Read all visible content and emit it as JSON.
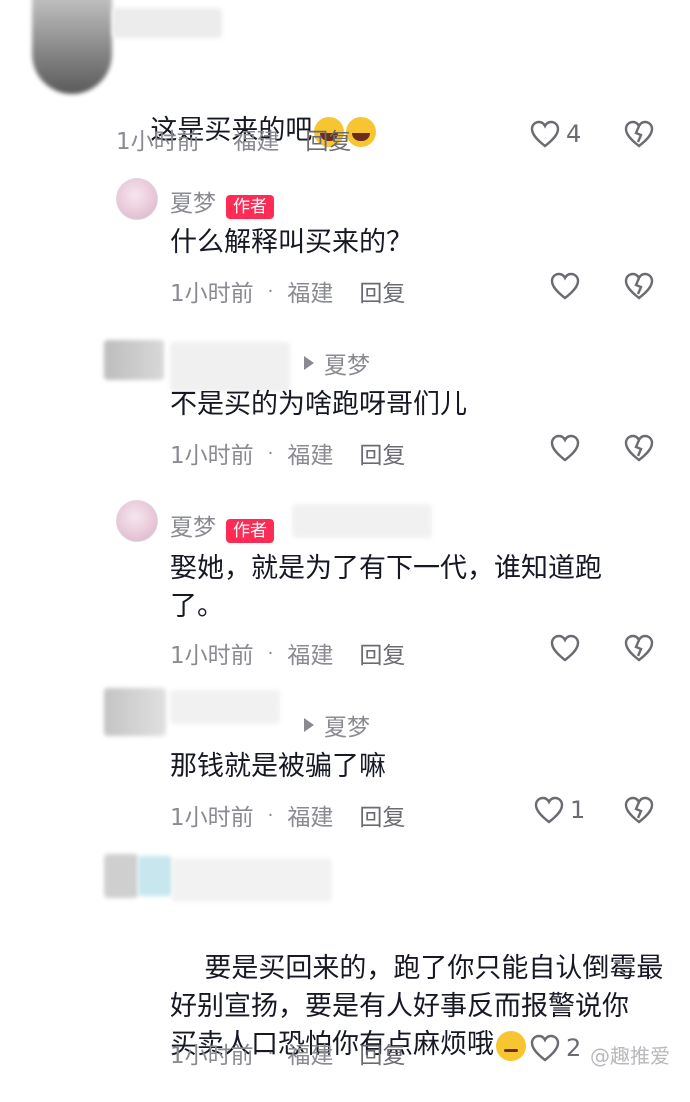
{
  "comments": [
    {
      "text": "这是买来的吧",
      "time": "1小时前",
      "location": "福建",
      "reply": "回复",
      "likes": "4"
    },
    {
      "name": "夏梦",
      "badge": "作者",
      "text": "什么解释叫买来的？",
      "time": "1小时前",
      "location": "福建",
      "reply": "回复"
    },
    {
      "reply_to": "夏梦",
      "text": "不是买的为啥跑呀哥们儿",
      "time": "1小时前",
      "location": "福建",
      "reply": "回复"
    },
    {
      "name": "夏梦",
      "badge": "作者",
      "text": "娶她，就是为了有下一代，谁知道跑\n了。",
      "time": "1小时前",
      "location": "福建",
      "reply": "回复"
    },
    {
      "reply_to": "夏梦",
      "text": "那钱就是被骗了嘛",
      "time": "1小时前",
      "location": "福建",
      "reply": "回复",
      "likes": "1"
    },
    {
      "text": "要是买回来的，跑了你只能自认倒霉最\n好别宣扬，要是有人好事反而报警说你\n买卖人口恐怕你有点麻烦哦",
      "time": "1小时前",
      "location": "福建",
      "reply": "回复",
      "likes": "2"
    }
  ],
  "watermark": "@趣推爱",
  "icons": {
    "like": "heart-outline-icon",
    "dislike": "broken-heart-icon",
    "laugh": "laughing-crying-emoji",
    "eyeroll": "eye-roll-emoji",
    "reply_arrow": "triangle-right-icon"
  },
  "colors": {
    "badge": "#fe2c55",
    "meta": "#8a8b91",
    "text": "#161823"
  }
}
